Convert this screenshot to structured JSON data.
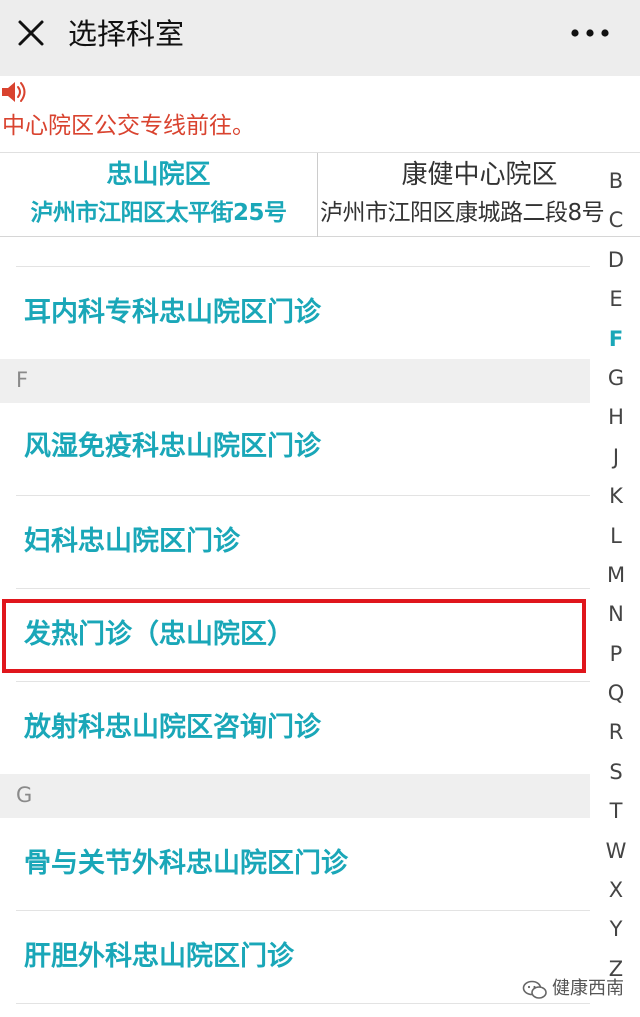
{
  "header": {
    "title": "选择科室",
    "close_icon": "close-icon",
    "more_icon": "more-icon"
  },
  "notice": {
    "text": "中心院区公交专线前往。",
    "icon": "speaker-icon",
    "color": "#d9432f"
  },
  "campuses": [
    {
      "name": "忠山院区",
      "address": "泸州市江阳区太平街25号",
      "selected": true
    },
    {
      "name": "康健中心院区",
      "address": "泸州市江阳区康城路二段8号",
      "selected": false
    }
  ],
  "departments": {
    "e_items": [
      "耳内科专科忠山院区门诊"
    ],
    "f_header": "F",
    "f_items": [
      "风湿免疫科忠山院区门诊",
      "妇科忠山院区门诊",
      "发热门诊（忠山院区）",
      "放射科忠山院区咨询门诊"
    ],
    "g_header": "G",
    "g_items": [
      "骨与关节外科忠山院区门诊",
      "肝胆外科忠山院区门诊"
    ]
  },
  "index": {
    "letters": [
      "B",
      "C",
      "D",
      "E",
      "F",
      "G",
      "H",
      "J",
      "K",
      "L",
      "M",
      "N",
      "P",
      "Q",
      "R",
      "S",
      "T",
      "W",
      "X",
      "Y",
      "Z"
    ],
    "active": "F"
  },
  "watermark": {
    "text": "健康西南",
    "icon": "wechat-icon"
  },
  "colors": {
    "accent": "#1aa7b8",
    "highlight": "#e0161c",
    "header_bg": "#ededed"
  }
}
